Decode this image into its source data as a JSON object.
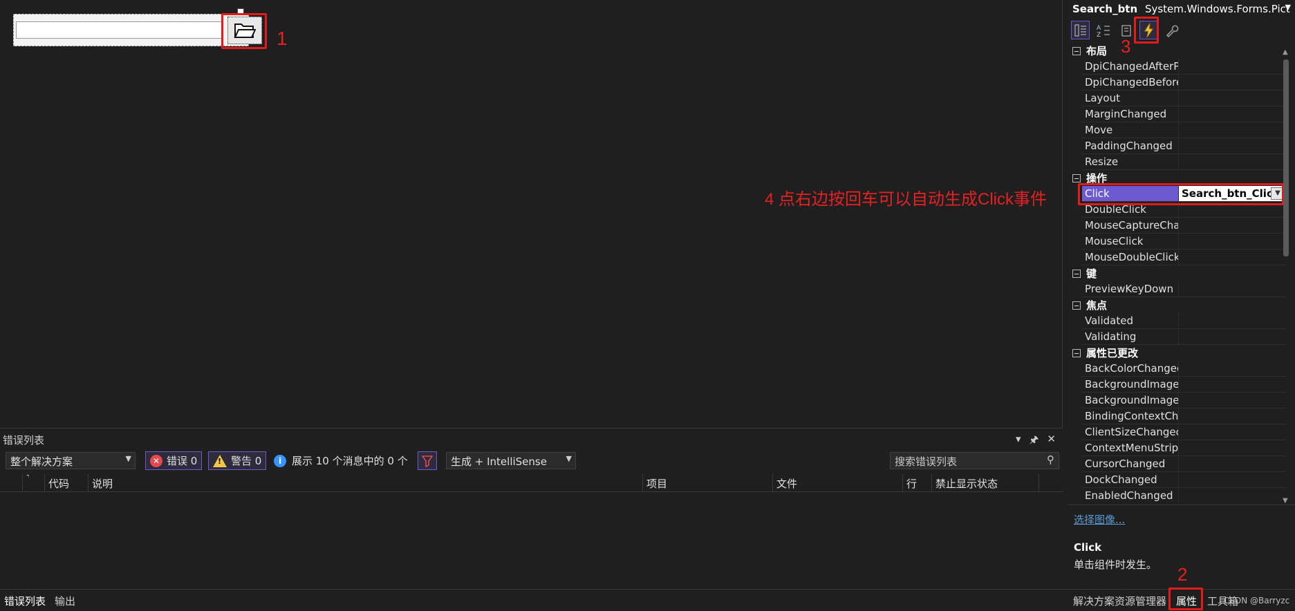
{
  "designer": {
    "annotation_1": "1"
  },
  "error_list": {
    "title": "错误列表",
    "ctrl_dropdown": "▾",
    "ctrl_pin": "🖈",
    "ctrl_close": "✕",
    "scope_combo": "整个解决方案",
    "errors_label": "错误 0",
    "warnings_label": "警告 0",
    "messages_label": "展示 10 个消息中的 0 个",
    "build_combo": "生成 + IntelliSense",
    "search_placeholder": "搜索错误列表",
    "columns": [
      "代码",
      "说明",
      "项目",
      "文件",
      "行",
      "禁止显示状态"
    ]
  },
  "bottom_tabs": {
    "left": [
      "错误列表",
      "输出"
    ],
    "right": [
      "解决方案资源管理器",
      "属性",
      "工具箱"
    ],
    "watermark": "CSDN @Barryzc",
    "annotation_2": "2"
  },
  "properties": {
    "object_name": "Search_btn",
    "object_type": "System.Windows.Forms.Pict",
    "annotation_3": "3",
    "categories": [
      {
        "name": "布局",
        "rows": [
          "DpiChangedAfterP",
          "DpiChangedBefore",
          "Layout",
          "MarginChanged",
          "Move",
          "PaddingChanged",
          "Resize"
        ]
      },
      {
        "name": "操作",
        "rows": [
          "Click",
          "DoubleClick",
          "MouseCaptureCha",
          "MouseClick",
          "MouseDoubleClick"
        ]
      },
      {
        "name": "键",
        "rows": [
          "PreviewKeyDown"
        ]
      },
      {
        "name": "焦点",
        "rows": [
          "Validated",
          "Validating"
        ]
      },
      {
        "name": "属性已更改",
        "rows": [
          "BackColorChangec",
          "BackgroundImage",
          "BackgroundImage",
          "BindingContextCh",
          "ClientSizeChangec",
          "ContextMenuStrip",
          "CursorChanged",
          "DockChanged",
          "EnabledChanged"
        ]
      }
    ],
    "click_value": "Search_btn_Click",
    "link": "选择图像...",
    "desc_title": "Click",
    "desc_text": "单击组件时发生。"
  },
  "annotation_4": "4 点右边按回车可以自动生成Click事件",
  "colors": {
    "accent": "#6d5ad0",
    "annotation_red": "#e31b1b",
    "background": "#1f1f1f"
  }
}
